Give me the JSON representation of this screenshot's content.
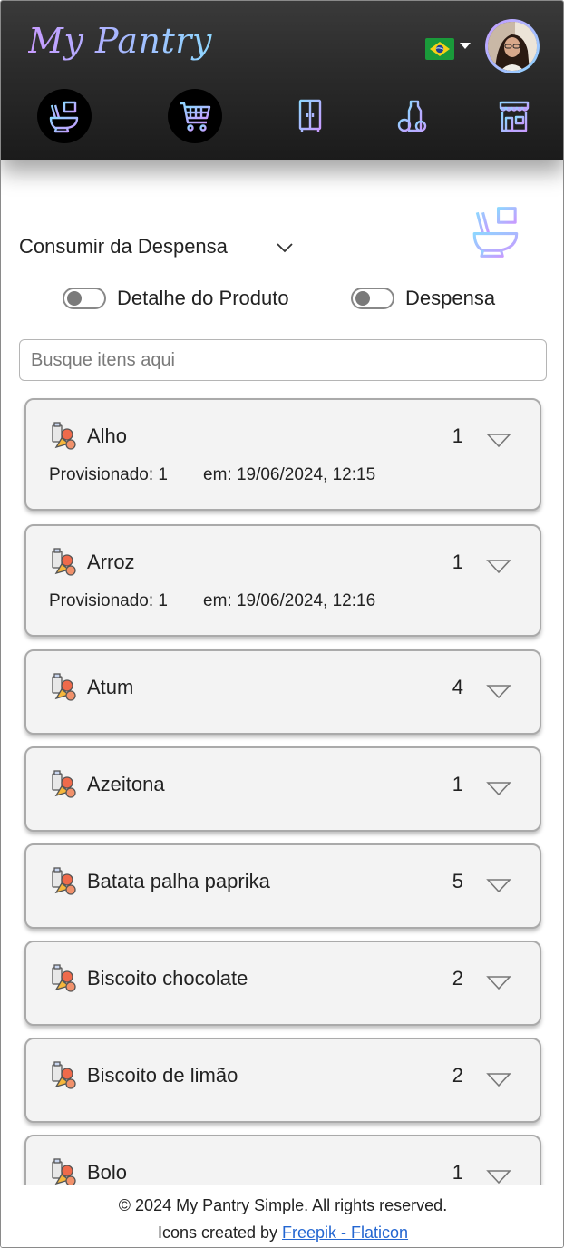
{
  "app": {
    "title": "My Pantry"
  },
  "header": {
    "language_flag": "brazil-flag",
    "nav": [
      {
        "name": "consume-nav-button",
        "icon": "toilet-icon",
        "active": true
      },
      {
        "name": "shopping-cart-nav-button",
        "icon": "shopping-cart-icon",
        "active": true
      },
      {
        "name": "pantry-nav-button",
        "icon": "cupboard-icon",
        "active": false
      },
      {
        "name": "products-nav-button",
        "icon": "groceries-icon",
        "active": false
      },
      {
        "name": "store-nav-button",
        "icon": "store-icon",
        "active": false
      }
    ]
  },
  "section": {
    "title": "Consumir da Despensa",
    "icon": "toilet-icon"
  },
  "toggles": {
    "product_detail": "Detalhe do Produto",
    "pantry": "Despensa"
  },
  "search": {
    "placeholder": "Busque itens aqui",
    "value": ""
  },
  "items": [
    {
      "name": "Alho",
      "qty": "1",
      "prov": "Provisionado: 1",
      "when": "em: 19/06/2024, 12:15"
    },
    {
      "name": "Arroz",
      "qty": "1",
      "prov": "Provisionado: 1",
      "when": "em: 19/06/2024, 12:16"
    },
    {
      "name": "Atum",
      "qty": "4"
    },
    {
      "name": "Azeitona",
      "qty": "1"
    },
    {
      "name": "Batata palha paprika",
      "qty": "5"
    },
    {
      "name": "Biscoito chocolate",
      "qty": "2"
    },
    {
      "name": "Biscoito de limão",
      "qty": "2"
    },
    {
      "name": "Bolo",
      "qty": "1"
    }
  ],
  "footer": {
    "copyright": "© 2024 My Pantry Simple. All rights reserved.",
    "icons_prefix": "Icons created by ",
    "icons_link": "Freepik - Flaticon"
  },
  "colors": {
    "header_bg": "#2c2c2c",
    "logo_gradient_start": "#c79bff",
    "logo_gradient_end": "#8ed6ff",
    "card_bg": "#f3f3f3",
    "link": "#2366d1"
  }
}
